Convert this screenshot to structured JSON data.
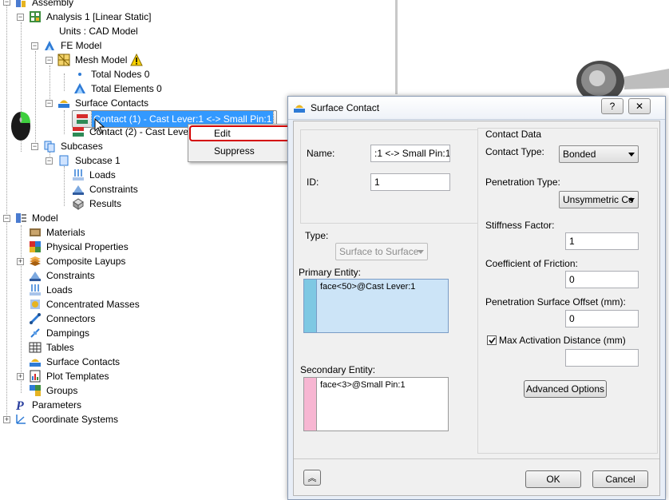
{
  "tree": {
    "assembly": "Assembly",
    "analysis": "Analysis 1 [Linear Static]",
    "units": "Units : CAD Model",
    "fe_model": "FE Model",
    "mesh_model": "Mesh Model",
    "total_nodes": "Total Nodes 0",
    "total_elements": "Total Elements 0",
    "surface_contacts": "Surface Contacts",
    "contact1": "Contact (1) - Cast Lever:1 <-> Small Pin:1",
    "contact2": "Contact (2) - Cast Leve",
    "subcases": "Subcases",
    "subcase1": "Subcase 1",
    "loads": "Loads",
    "constraints": "Constraints",
    "results": "Results",
    "model": "Model",
    "materials": "Materials",
    "physical_properties": "Physical Properties",
    "composite_layups": "Composite Layups",
    "m_constraints": "Constraints",
    "m_loads": "Loads",
    "concentrated_masses": "Concentrated Masses",
    "connectors": "Connectors",
    "dampings": "Dampings",
    "tables": "Tables",
    "m_surface_contacts": "Surface Contacts",
    "plot_templates": "Plot Templates",
    "groups": "Groups",
    "parameters": "Parameters",
    "coordinate_systems": "Coordinate Systems"
  },
  "context_menu": {
    "edit": "Edit",
    "suppress": "Suppress"
  },
  "dialog": {
    "title": "Surface Contact",
    "help_btn": "?",
    "name_label": "Name:",
    "name_value": ":1 <-> Small Pin:1",
    "id_label": "ID:",
    "id_value": "1",
    "type_label": "Type:",
    "type_value": "Surface to Surface",
    "primary_label": "Primary Entity:",
    "primary_value": "face<50>@Cast Lever:1",
    "secondary_label": "Secondary Entity:",
    "secondary_value": "face<3>@Small Pin:1",
    "contact_data_label": "Contact Data",
    "contact_type_label": "Contact Type:",
    "contact_type_value": "Bonded",
    "penetration_type_label": "Penetration Type:",
    "penetration_type_value": "Unsymmetric Co",
    "stiffness_label": "Stiffness Factor:",
    "stiffness_value": "1",
    "friction_label": "Coefficient of Friction:",
    "friction_value": "0",
    "offset_label": "Penetration Surface Offset (mm):",
    "offset_value": "0",
    "max_activation_label": "Max Activation Distance (mm)",
    "max_activation_value": "",
    "advanced_btn": "Advanced Options",
    "ok_btn": "OK",
    "cancel_btn": "Cancel",
    "primary_color": "#7ec8e3",
    "secondary_color": "#f7b6d2"
  }
}
